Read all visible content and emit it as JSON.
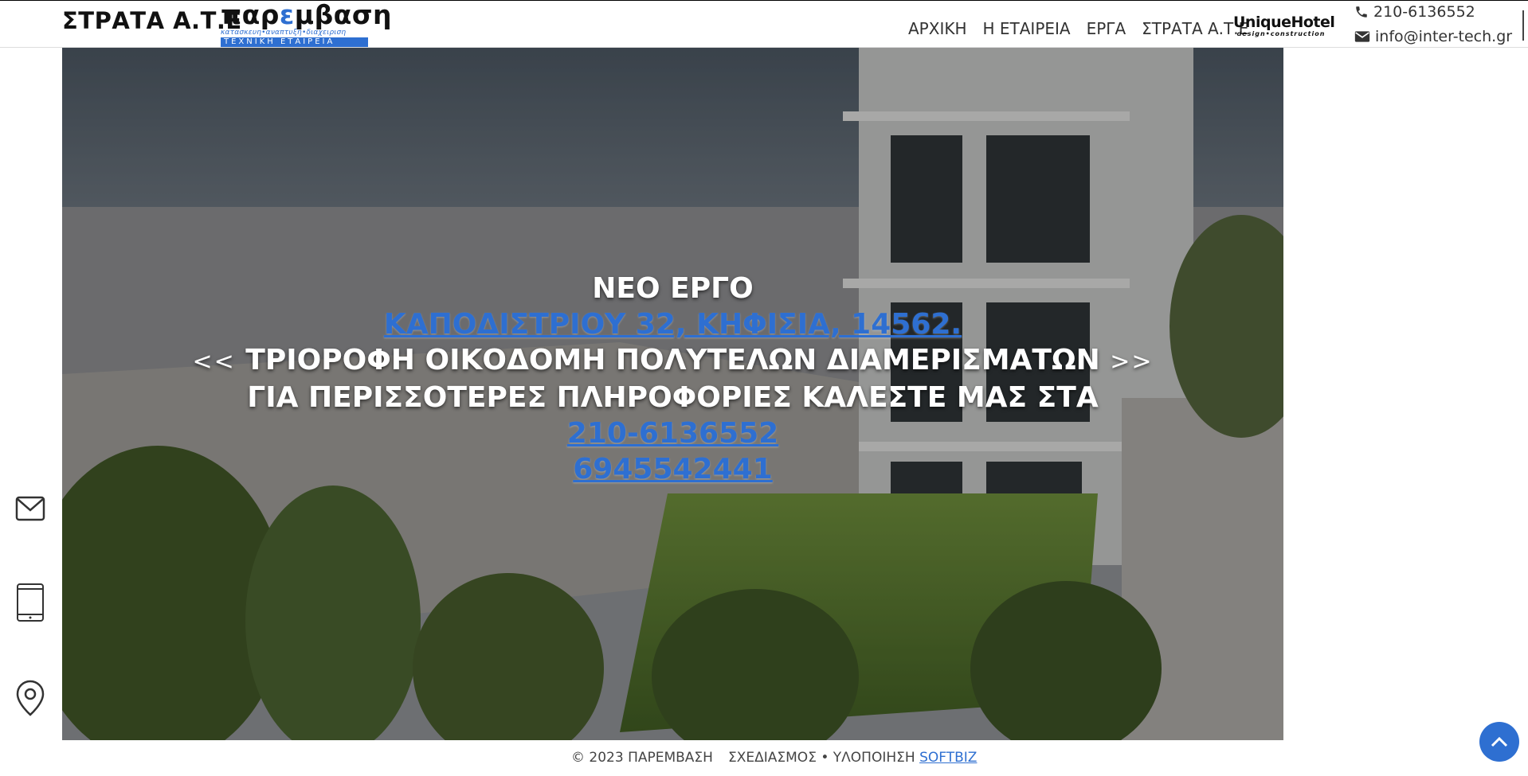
{
  "header": {
    "brand_text": "ΣΤΡΑΤΑ Α.Τ.Ε",
    "logo": {
      "word_prefix": "παρ",
      "word_accent": "ε",
      "word_suffix": "μβαση",
      "tagline": "κατασκευη•αναπτυξη•διαχειριση",
      "bar_text": "ΤΕΧΝΙΚΗ ΕΤΑΙΡΕΙΑ"
    },
    "nav": [
      {
        "label": "ΑΡΧΙΚΗ"
      },
      {
        "label": "Η ΕΤΑΙΡΕΙΑ"
      },
      {
        "label": "ΕΡΓΑ"
      },
      {
        "label": "ΣΤΡΑΤΑ Α.Τ.Ε"
      }
    ],
    "hotel_logo": {
      "name": "UniqueHotel",
      "tag": "design•construction"
    },
    "phone": "210-6136552",
    "email": "info@inter-tech.gr"
  },
  "hero": {
    "line1": "ΝΕΟ ΕΡΓΟ",
    "address_link": "ΚΑΠΟΔΙΣΤΡΙΟΥ 32, ΚΗΦΙΣΙΑ, 14562.",
    "line3_prefix": "<<",
    "line3_main": "ΤΡΙΟΡΟΦΗ ΟΙΚΟΔΟΜΗ ΠΟΛΥΤΕΛΩΝ ΔΙΑΜΕΡΙΣΜΑΤΩΝ",
    "line3_suffix": ">>",
    "line4": "ΓΙΑ ΠΕΡΙΣΣΟΤΕΡΕΣ ΠΛΗΡΟΦΟΡΙΕΣ ΚΑΛΕΣΤΕ ΜΑΣ ΣΤΑ",
    "phone1": "210-6136552",
    "phone2": "6945542441"
  },
  "side_icons": [
    "mail-icon",
    "phone-icon",
    "location-icon"
  ],
  "footer": {
    "copyright": "© 2023 ΠΑΡΕΜΒΑΣΗ",
    "credit_prefix": "ΣΧΕΔΙΑΣΜΟΣ • ΥΛΟΠΟΙΗΣΗ",
    "credit_link": "SOFTBIZ"
  },
  "colors": {
    "accent": "#2e6fd1",
    "text": "#333333",
    "overlay": "#000000"
  }
}
